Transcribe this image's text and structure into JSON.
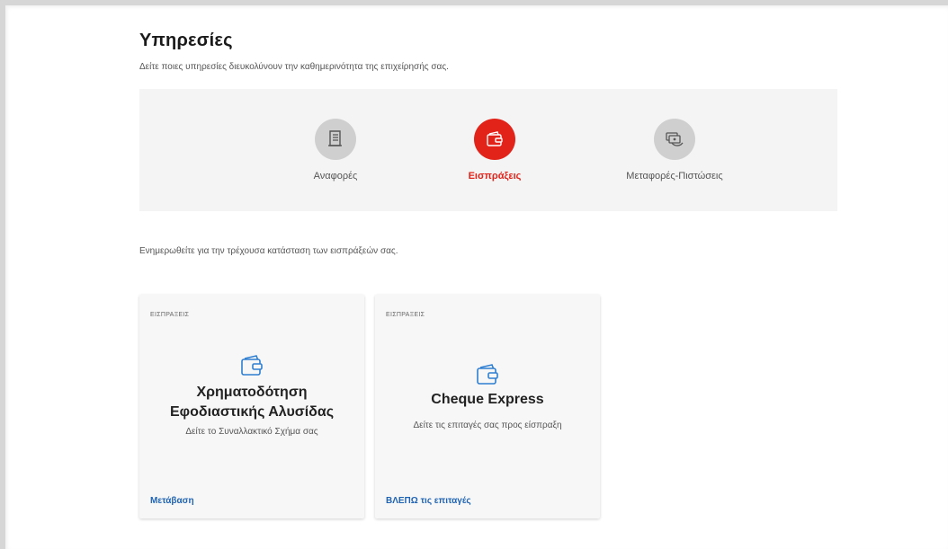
{
  "header": {
    "title": "Υπηρεσίες",
    "subtitle": "Δείτε ποιες υπηρεσίες διευκολύνουν την καθημερινότητα της επιχείρησής σας."
  },
  "services": [
    {
      "label": "Αναφορές",
      "icon": "document-icon",
      "active": false
    },
    {
      "label": "Εισπράξεις",
      "icon": "wallet-icon",
      "active": true
    },
    {
      "label": "Μεταφορές-Πιστώσεις",
      "icon": "money-transfer-icon",
      "active": false
    }
  ],
  "section": {
    "description": "Ενημερωθείτε για την τρέχουσα κατάσταση των εισπράξεών σας."
  },
  "cards": [
    {
      "tag": "ΕΙΣΠΡΑΞΕΙΣ",
      "icon": "wallet-icon",
      "title_line1": "Χρηματοδότηση",
      "title_line2": "Εφοδιαστικής Αλυσίδας",
      "text": "Δείτε το Συναλλακτικό Σχήμα σας",
      "link": "Μετάβαση"
    },
    {
      "tag": "ΕΙΣΠΡΑΞΕΙΣ",
      "icon": "wallet-icon",
      "title_line1": "Cheque Express",
      "text": "Δείτε τις επιταγές σας προς είσπραξη",
      "link": "ΒΛΕΠΩ τις επιταγές"
    }
  ],
  "colors": {
    "accent": "#e2231a",
    "link": "#1f63b3",
    "icon_blue": "#2f7fd1",
    "inactive_circle": "#cfcfcf"
  }
}
